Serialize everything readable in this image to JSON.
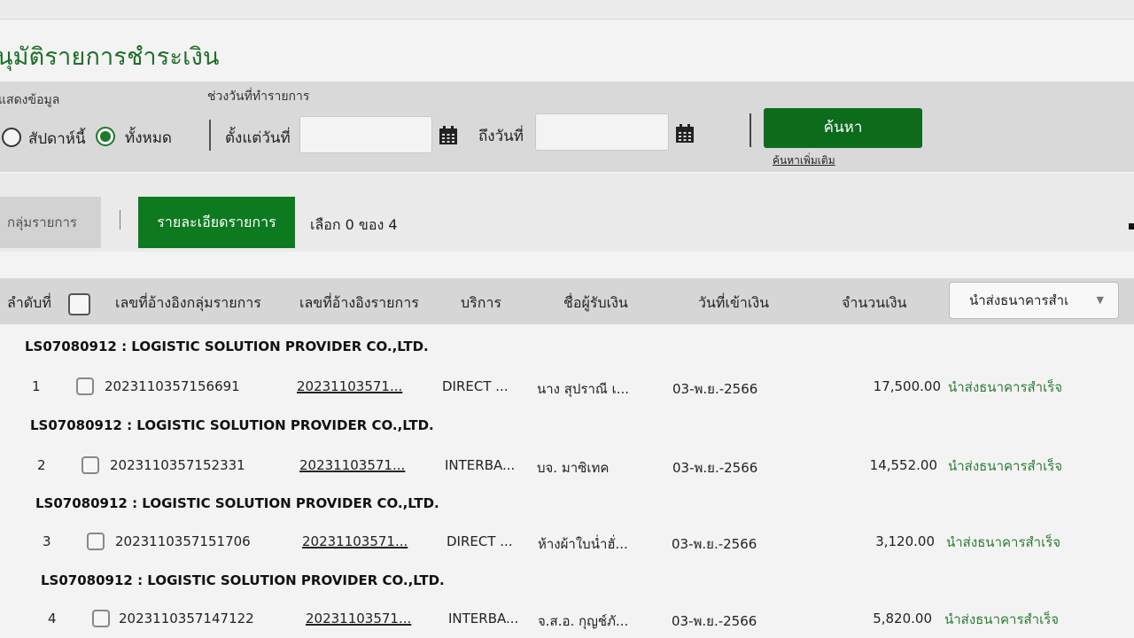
{
  "page": {
    "title": "นุมัติรายการชำระเงิน"
  },
  "filters": {
    "display_label": "แสดงข้อมูล",
    "range_label": "ช่วงวันที่ทำรายการ",
    "option_this_week": "สัปดาห์นี้",
    "option_all": "ทั้งหมด",
    "selected_option": "all",
    "from_label": "ตั้งแต่วันที่",
    "from_value": "",
    "to_label": "ถึงวันที่",
    "to_value": "",
    "search_button": "ค้นหา",
    "advanced_search_link": "ค้นหาเพิ่มเติม"
  },
  "tabs": {
    "group_tab": "กลุ่มรายการ",
    "detail_tab": "รายละเอียดรายการ",
    "active": "detail",
    "selection_text": "เลือก 0 ของ 4"
  },
  "table": {
    "headers": {
      "seq": "ลำดับที่",
      "group_ref": "เลขที่อ้างอิงกลุ่มรายการ",
      "txn_ref": "เลขที่อ้างอิงรายการ",
      "service": "บริการ",
      "payee": "ชื่อผู้รับเงิน",
      "credit_date": "วันที่เข้าเงิน",
      "amount": "จำนวนเงิน",
      "status_filter": "นำส่งธนาคารสำเ"
    },
    "rows": [
      {
        "group": "LS07080912 : LOGISTIC SOLUTION PROVIDER CO.,LTD.",
        "seq": "1",
        "group_ref": "2023110357156691",
        "txn_ref": "20231103571...",
        "service": "DIRECT ...",
        "payee": "นาง สุปราณี เ...",
        "credit_date": "03-พ.ย.-2566",
        "amount": "17,500.00",
        "status": "นำส่งธนาคารสำเร็จ"
      },
      {
        "group": "LS07080912 : LOGISTIC SOLUTION PROVIDER CO.,LTD.",
        "seq": "2",
        "group_ref": "2023110357152331",
        "txn_ref": "20231103571...",
        "service": "INTERBA...",
        "payee": "บจ. มาซิเทค",
        "credit_date": "03-พ.ย.-2566",
        "amount": "14,552.00",
        "status": "นำส่งธนาคารสำเร็จ"
      },
      {
        "group": "LS07080912 : LOGISTIC SOLUTION PROVIDER CO.,LTD.",
        "seq": "3",
        "group_ref": "2023110357151706",
        "txn_ref": "20231103571...",
        "service": "DIRECT ...",
        "payee": "ห้างผ้าใบน่ำฮั่...",
        "credit_date": "03-พ.ย.-2566",
        "amount": "3,120.00",
        "status": "นำส่งธนาคารสำเร็จ"
      },
      {
        "group": "LS07080912 : LOGISTIC SOLUTION PROVIDER CO.,LTD.",
        "seq": "4",
        "group_ref": "2023110357147122",
        "txn_ref": "20231103571...",
        "service": "INTERBA...",
        "payee": "จ.ส.อ. กุญช์ภั...",
        "credit_date": "03-พ.ย.-2566",
        "amount": "5,820.00",
        "status": "นำส่งธนาคารสำเร็จ"
      }
    ]
  },
  "colors": {
    "primary_green": "#0d7a20",
    "title_green": "#1f6e2a",
    "status_green": "#2c7d34"
  },
  "icons": {
    "calendar": "calendar-icon",
    "dropdown": "chevron-down-icon"
  }
}
